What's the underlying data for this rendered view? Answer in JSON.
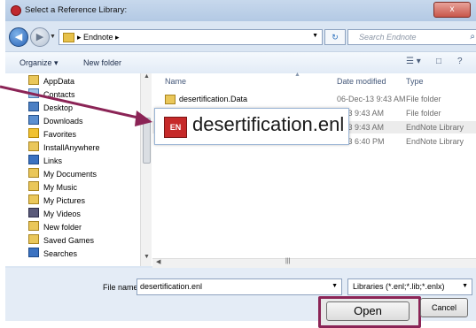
{
  "window": {
    "title": "Select a Reference Library:",
    "close_glyph": "x"
  },
  "address": {
    "crumb": "▸ Endnote ▸",
    "refresh_glyph": "↻",
    "search_placeholder": "Search Endnote",
    "search_glyph": "⌕"
  },
  "toolbar": {
    "organize": "Organize ▾",
    "new_folder": "New folder",
    "views_glyph": "☰ ▾",
    "preview_glyph": "□",
    "help_glyph": "?"
  },
  "nav": {
    "items": [
      "AppData",
      "Contacts",
      "Desktop",
      "Downloads",
      "Favorites",
      "InstallAnywhere",
      "Links",
      "My Documents",
      "My Music",
      "My Pictures",
      "My Videos",
      "New folder",
      "Saved Games",
      "Searches"
    ]
  },
  "list": {
    "headers": {
      "name": "Name",
      "date": "Date modified",
      "type": "Type"
    },
    "rows": [
      {
        "name": "desertification.Data",
        "date": "06-Dec-13 9:43 AM",
        "type": "File folder"
      },
      {
        "name": "",
        "date": "c-13 9:43 AM",
        "type": "File folder"
      },
      {
        "name": "",
        "date": "c-13 9:43 AM",
        "type": "EndNote Library"
      },
      {
        "name": "",
        "date": "v-13 6:40 PM",
        "type": "EndNote Library"
      }
    ],
    "big_label": "desertification.enl",
    "big_icon_text": "EN"
  },
  "bottom": {
    "file_name_label": "File name:",
    "file_name_value": "desertification.enl",
    "file_type": "Libraries (*.enl;*.lib;*.enlx)",
    "open": "Open",
    "cancel": "Cancel"
  },
  "colors": {
    "arrow": "#8b2456",
    "highlight_border": "#8b2456"
  }
}
